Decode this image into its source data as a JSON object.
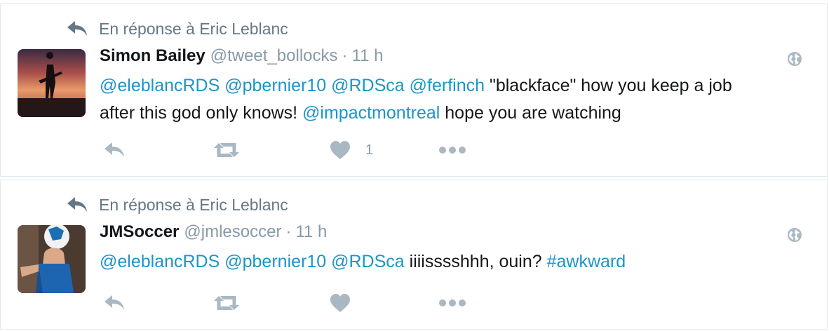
{
  "tweets": [
    {
      "context": "En réponse à Eric Leblanc",
      "fullname": "Simon Bailey",
      "username": "@tweet_bollocks",
      "dot": "·",
      "time": "11 h",
      "line1": [
        {
          "t": "@eleblancRDS",
          "link": true
        },
        {
          "t": " ",
          "link": false
        },
        {
          "t": "@pbernier10",
          "link": true
        },
        {
          "t": " ",
          "link": false
        },
        {
          "t": "@RDSca",
          "link": true
        },
        {
          "t": " ",
          "link": false
        },
        {
          "t": "@ferfinch",
          "link": true
        },
        {
          "t": " \"blackface\" how you keep a job",
          "link": false
        }
      ],
      "line2": [
        {
          "t": "after this god only knows! ",
          "link": false
        },
        {
          "t": "@impactmontreal",
          "link": true
        },
        {
          "t": " hope you are watching",
          "link": false
        }
      ],
      "like_count": "1",
      "icons": {
        "context": "reply-icon",
        "reply": "reply-icon",
        "retweet": "retweet-icon",
        "like": "heart-icon",
        "more": "more-icon",
        "globe": "globe-icon"
      }
    },
    {
      "context": "En réponse à Eric Leblanc",
      "fullname": "JMSoccer",
      "username": "@jmlesoccer",
      "dot": "·",
      "time": "11 h",
      "line1": [
        {
          "t": "@eleblancRDS",
          "link": true
        },
        {
          "t": " ",
          "link": false
        },
        {
          "t": "@pbernier10",
          "link": true
        },
        {
          "t": " ",
          "link": false
        },
        {
          "t": "@RDSca",
          "link": true
        },
        {
          "t": " iiiisssshhh, ouin? ",
          "link": false
        },
        {
          "t": "#awkward",
          "link": true
        }
      ],
      "like_count": "",
      "icons": {
        "context": "reply-icon",
        "reply": "reply-icon",
        "retweet": "retweet-icon",
        "like": "heart-icon",
        "more": "more-icon",
        "globe": "globe-icon"
      }
    }
  ],
  "colors": {
    "link": "#1b95c8",
    "muted": "#8899a6",
    "icon": "#aab8c2",
    "text": "#14171a",
    "border": "#e1e8ed"
  }
}
